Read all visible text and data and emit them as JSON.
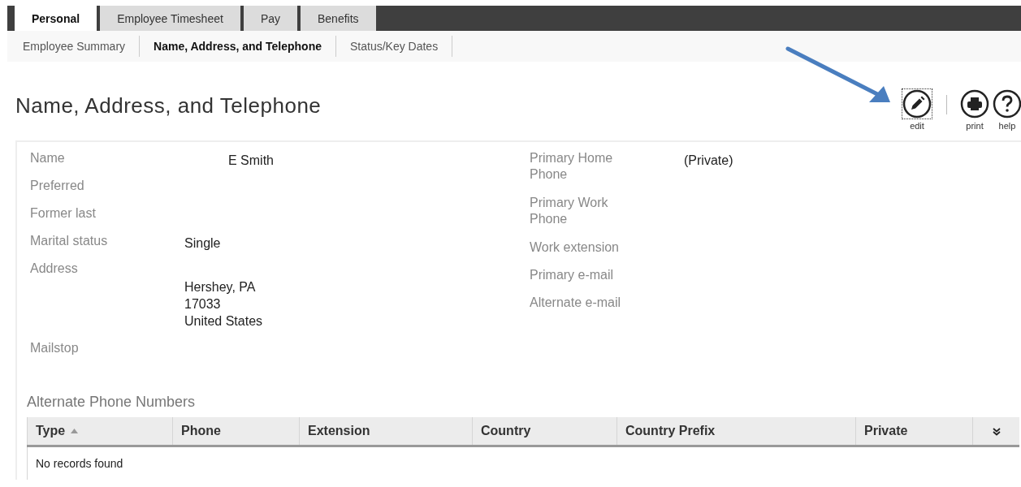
{
  "tabs": [
    {
      "label": "Personal",
      "selected": true
    },
    {
      "label": "Employee Timesheet",
      "selected": false
    },
    {
      "label": "Pay",
      "selected": false
    },
    {
      "label": "Benefits",
      "selected": false
    }
  ],
  "subnav": [
    {
      "label": "Employee Summary",
      "selected": false
    },
    {
      "label": "Name, Address, and Telephone",
      "selected": true
    },
    {
      "label": "Status/Key Dates",
      "selected": false
    }
  ],
  "page_title": "Name, Address, and Telephone",
  "actions": [
    {
      "kind": "edit",
      "label": "edit",
      "focused": true
    },
    {
      "kind": "print",
      "label": "print",
      "focused": false
    },
    {
      "kind": "help",
      "label": "help",
      "focused": false
    }
  ],
  "left_fields": [
    {
      "kind": "indented",
      "label": "Name",
      "value": [
        "E Smith"
      ]
    },
    {
      "kind": "plain",
      "label": "Preferred"
    },
    {
      "kind": "plain",
      "label": "Former last"
    },
    {
      "kind": "plain",
      "label": "Marital status",
      "value": [
        "Single"
      ]
    },
    {
      "kind": "lowered",
      "label": "Address",
      "value": [
        "Hershey, PA",
        "17033",
        "United States"
      ]
    },
    {
      "kind": "plain",
      "label": "Mailstop"
    }
  ],
  "right_fields": [
    {
      "kind": "plain",
      "label": "Primary Home Phone",
      "value": [
        "(Private)"
      ]
    },
    {
      "kind": "plain",
      "label": "Primary Work Phone"
    },
    {
      "kind": "plain",
      "label": "Work extension"
    },
    {
      "kind": "plain",
      "label": "Primary e-mail"
    },
    {
      "kind": "plain",
      "label": "Alternate e-mail"
    }
  ],
  "alternate_phones": {
    "title": "Alternate Phone Numbers",
    "columns": [
      {
        "label": "Type",
        "sorted": true
      },
      {
        "label": "Phone",
        "sorted": false
      },
      {
        "label": "Extension",
        "sorted": false
      },
      {
        "label": "Country",
        "sorted": false
      },
      {
        "label": "Country Prefix",
        "sorted": false
      },
      {
        "label": "Private",
        "sorted": false
      }
    ],
    "empty_message": "No records found"
  }
}
